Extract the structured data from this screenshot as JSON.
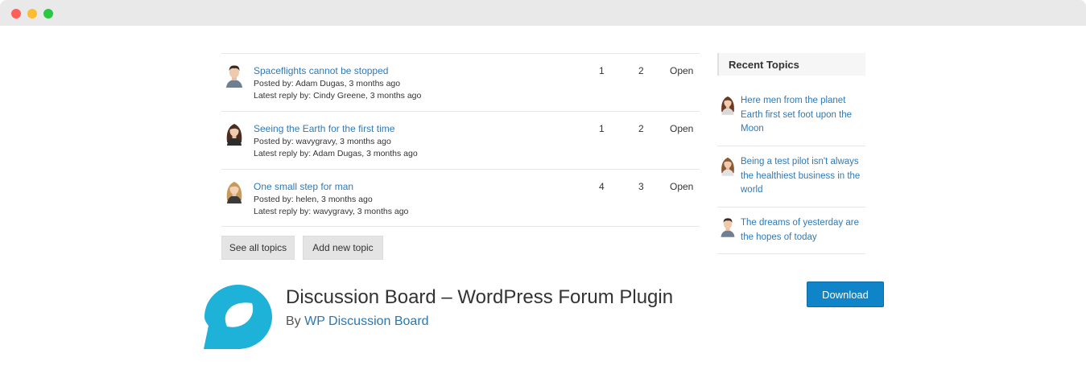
{
  "topics": [
    {
      "title": "Spaceflights cannot be stopped",
      "posted_by": "Posted by: Adam Dugas, 3 months ago",
      "latest_reply": "Latest reply by: Cindy Greene, 3 months ago",
      "voices": "1",
      "posts": "2",
      "status": "Open",
      "avatar": "male-avatar"
    },
    {
      "title": "Seeing the Earth for the first time",
      "posted_by": "Posted by: wavygravy, 3 months ago",
      "latest_reply": "Latest reply by: Adam Dugas, 3 months ago",
      "voices": "1",
      "posts": "2",
      "status": "Open",
      "avatar": "female-avatar"
    },
    {
      "title": "One small step for man",
      "posted_by": "Posted by: helen, 3 months ago",
      "latest_reply": "Latest reply by: wavygravy, 3 months ago",
      "voices": "4",
      "posts": "3",
      "status": "Open",
      "avatar": "female-avatar-blonde"
    }
  ],
  "buttons": {
    "see_all": "See all topics",
    "add_new": "Add new topic"
  },
  "sidebar": {
    "heading": "Recent Topics",
    "items": [
      {
        "title": "Here men from the planet Earth first set foot upon the Moon",
        "avatar": "female-avatar"
      },
      {
        "title": "Being a test pilot isn't always the healthiest business in the world",
        "avatar": "female-avatar"
      },
      {
        "title": "The dreams of yesterday are the hopes of today",
        "avatar": "male-avatar"
      }
    ]
  },
  "plugin": {
    "title": "Discussion Board – WordPress Forum Plugin",
    "by_prefix": "By",
    "author": "WP Discussion Board",
    "download_label": "Download",
    "logo_icon": "discussion-board-logo-icon",
    "brand_color": "#1fb2d8"
  }
}
